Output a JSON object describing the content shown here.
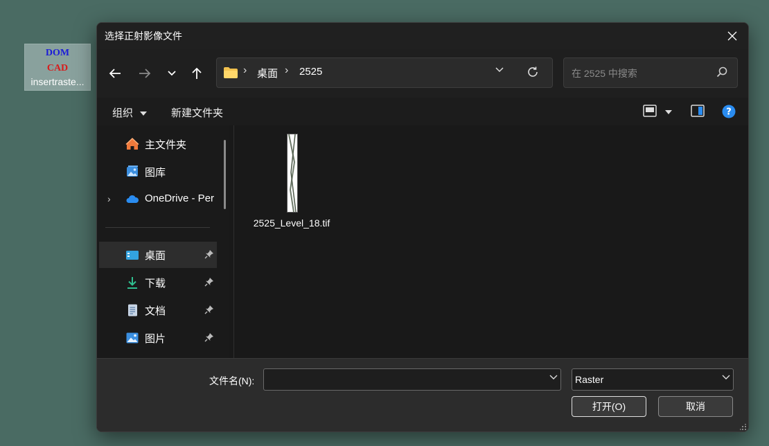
{
  "desktop_icon": {
    "thumb_line1": "DOM",
    "thumb_line2": "CAD",
    "label": "insertraste..."
  },
  "dialog": {
    "title": "选择正射影像文件",
    "address": {
      "crumbs": [
        "桌面",
        "2525"
      ]
    },
    "search": {
      "placeholder": "在 2525 中搜索"
    },
    "toolbar": {
      "organize": "组织",
      "new_folder": "新建文件夹"
    },
    "sidebar": {
      "items": [
        {
          "label": "主文件夹",
          "icon": "home-icon"
        },
        {
          "label": "图库",
          "icon": "gallery-icon"
        },
        {
          "label": "OneDrive - Per",
          "icon": "onedrive-icon"
        },
        {
          "label": "桌面",
          "icon": "desktop-icon"
        },
        {
          "label": "下载",
          "icon": "download-icon"
        },
        {
          "label": "文档",
          "icon": "document-icon"
        },
        {
          "label": "图片",
          "icon": "pictures-icon"
        }
      ]
    },
    "files": [
      {
        "name": "2525_Level_18.tif"
      }
    ],
    "bottom": {
      "filename_label": "文件名(N):",
      "filename_value": "",
      "filetype": "Raster",
      "open_button": "打开(O)",
      "cancel_button": "取消"
    }
  },
  "colors": {
    "desktop_bg": "#4a6b63",
    "dialog_bg": "#191919",
    "accent_blue": "#2a8cf0",
    "folder_yellow": "#f2c14e"
  }
}
